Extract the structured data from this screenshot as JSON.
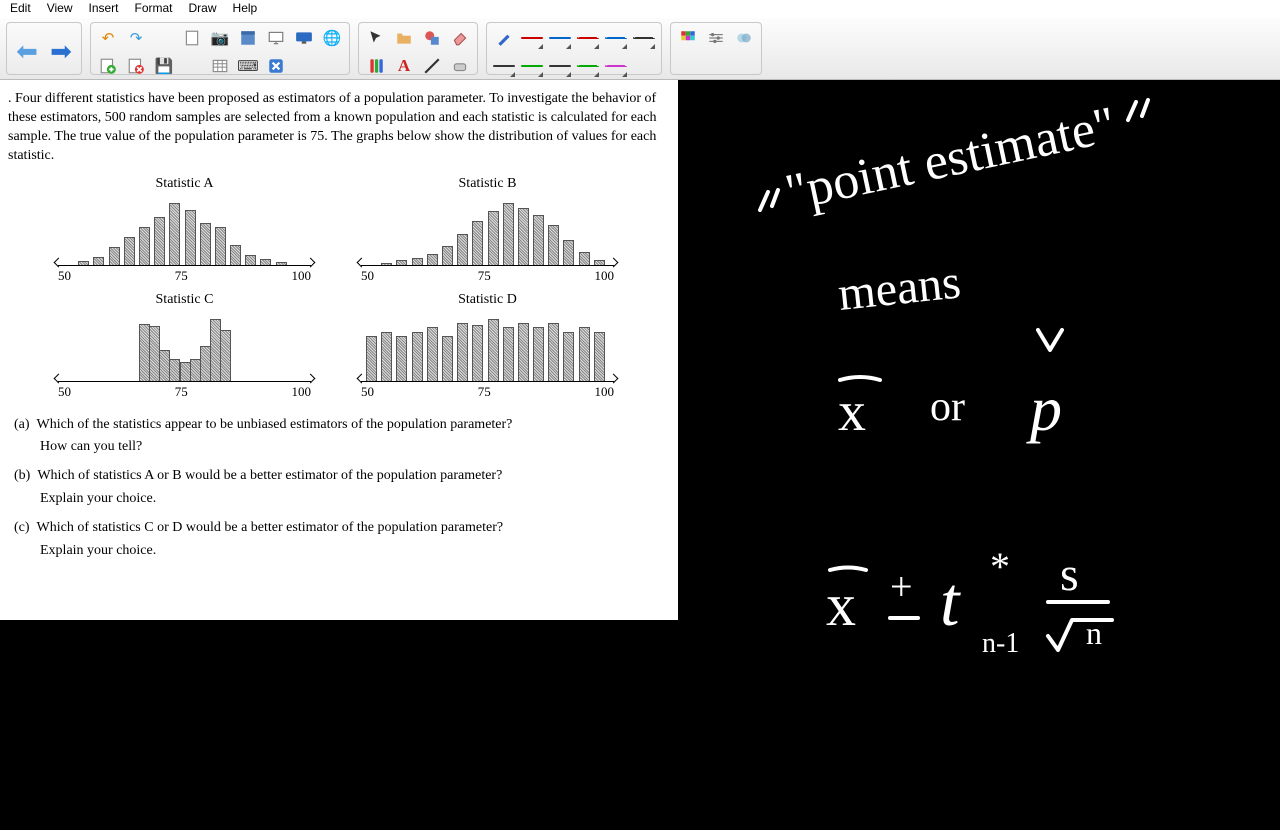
{
  "menu": {
    "items": [
      "Edit",
      "View",
      "Insert",
      "Format",
      "Draw",
      "Help"
    ]
  },
  "toolbar": {
    "nav_back": "Back",
    "nav_fwd": "Forward",
    "undo": "Undo",
    "redo": "Redo",
    "new": "New",
    "open": "Open",
    "save": "Save",
    "new_page": "New Page",
    "camera": "Screenshot",
    "table": "Table",
    "screen": "Presentation",
    "monitor": "Monitor",
    "globe": "Web",
    "add_page": "Add",
    "del_page": "Delete",
    "save2": "Save",
    "grid": "Grid",
    "keyboard": "Keyboard",
    "close": "Close",
    "pointer": "Pointer",
    "folder": "Folder",
    "shape": "Shapes",
    "eraser_big": "Eraser",
    "pens": "Pens",
    "text": "Text",
    "line": "Line",
    "eraser": "Eraser",
    "pen": "Pen",
    "palette": "Palette",
    "settings": "Settings",
    "link": "Link",
    "line_colors": [
      "#333",
      "#c00",
      "#0a0",
      "#06c",
      "#333",
      "#c00",
      "#0a0",
      "#06c",
      "#c3c",
      "#333"
    ]
  },
  "doc": {
    "intro": "Four different statistics have been proposed as estimators of a population parameter. To investigate the behavior of these estimators, 500 random samples are selected from a known population and each statistic is calculated for each sample. The true value of the population parameter is 75. The graphs below show the distribution of values for each statistic.",
    "charts": {
      "A": {
        "title": "Statistic A"
      },
      "B": {
        "title": "Statistic B"
      },
      "C": {
        "title": "Statistic C"
      },
      "D": {
        "title": "Statistic D"
      }
    },
    "axis": {
      "min": "50",
      "mid": "75",
      "max": "100"
    },
    "qa_label": "(a)",
    "qa": "Which of the statistics appear to be unbiased estimators of the population parameter?",
    "qa2": "How can you tell?",
    "qb_label": "(b)",
    "qb": "Which of statistics A or B would be a better estimator of the population parameter?",
    "qb2": "Explain your choice.",
    "qc_label": "(c)",
    "qc": "Which of statistics C or D would be a better estimator of the population parameter?",
    "qc2": "Explain your choice."
  },
  "chart_data": [
    {
      "type": "bar",
      "title": "Statistic A",
      "xlabel": "",
      "ylabel": "",
      "categories": [
        55,
        58,
        61,
        64,
        67,
        70,
        73,
        76,
        79,
        82,
        85,
        88,
        91,
        94
      ],
      "values": [
        4,
        8,
        18,
        28,
        38,
        48,
        62,
        55,
        42,
        38,
        20,
        10,
        6,
        3
      ],
      "xlim": [
        50,
        100
      ]
    },
    {
      "type": "bar",
      "title": "Statistic B",
      "xlabel": "",
      "ylabel": "",
      "categories": [
        55,
        58,
        61,
        64,
        67,
        70,
        73,
        76,
        79,
        82,
        85,
        88,
        91,
        94,
        97
      ],
      "values": [
        2,
        4,
        6,
        10,
        18,
        30,
        42,
        52,
        60,
        55,
        48,
        38,
        24,
        12,
        4
      ],
      "xlim": [
        50,
        100
      ]
    },
    {
      "type": "bar",
      "title": "Statistic C",
      "xlabel": "",
      "ylabel": "",
      "categories": [
        67,
        69,
        71,
        73,
        75,
        77,
        79,
        81,
        83
      ],
      "values": [
        62,
        60,
        34,
        24,
        20,
        24,
        38,
        68,
        56
      ],
      "xlim": [
        50,
        100
      ]
    },
    {
      "type": "bar",
      "title": "Statistic D",
      "xlabel": "",
      "ylabel": "",
      "categories": [
        52,
        55,
        58,
        61,
        64,
        67,
        70,
        73,
        76,
        79,
        82,
        85,
        88,
        91,
        94,
        97
      ],
      "values": [
        20,
        22,
        20,
        22,
        24,
        20,
        26,
        25,
        28,
        24,
        26,
        24,
        26,
        22,
        24,
        22
      ],
      "xlim": [
        50,
        100
      ]
    }
  ],
  "handwriting": {
    "line1": "\"point estimate\"",
    "line2": "means",
    "line3": "x̄   or   p̂",
    "line4": "x̄ ± t*_{n-1} s/√n"
  }
}
